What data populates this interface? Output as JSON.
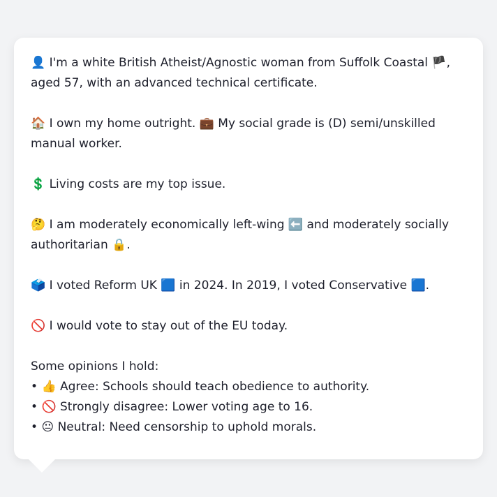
{
  "profile": {
    "identity": {
      "emoji_person": "👤",
      "text_a": "I'm a white British Atheist/Agnostic woman from Suffolk Coastal",
      "emoji_flag": "🏴",
      "text_b": ", aged 57, with an advanced technical certificate."
    },
    "home": {
      "emoji_house": "🏠",
      "text_a": "I own my home outright.",
      "emoji_briefcase": "💼",
      "text_b": "My social grade is (D) semi/unskilled manual worker."
    },
    "issue": {
      "emoji": "💲",
      "text": "Living costs are my top issue."
    },
    "ideology": {
      "emoji_think": "🤔",
      "text_a": "I am moderately economically left-wing",
      "emoji_arrow": "⬅️",
      "text_b": "and moderately socially authoritarian",
      "emoji_lock": "🔒",
      "text_c": "."
    },
    "votes": {
      "emoji_ballot": "🗳️",
      "text_a": "I voted Reform UK",
      "emoji_square_1": "🟦",
      "text_b": "in 2024. In 2019, I voted Conservative",
      "emoji_square_2": "🟦",
      "text_c": "."
    },
    "eu": {
      "emoji": "🚫",
      "text": "I would vote to stay out of the EU today."
    },
    "opinions": {
      "heading": "Some opinions I hold:",
      "items": [
        {
          "bullet": "•",
          "emoji": "👍",
          "text": "Agree: Schools should teach obedience to authority."
        },
        {
          "bullet": "•",
          "emoji": "🚫",
          "text": "Strongly disagree: Lower voting age to 16."
        },
        {
          "bullet": "•",
          "emoji": "😐",
          "text": "Neutral: Need censorship to uphold morals."
        }
      ]
    }
  }
}
